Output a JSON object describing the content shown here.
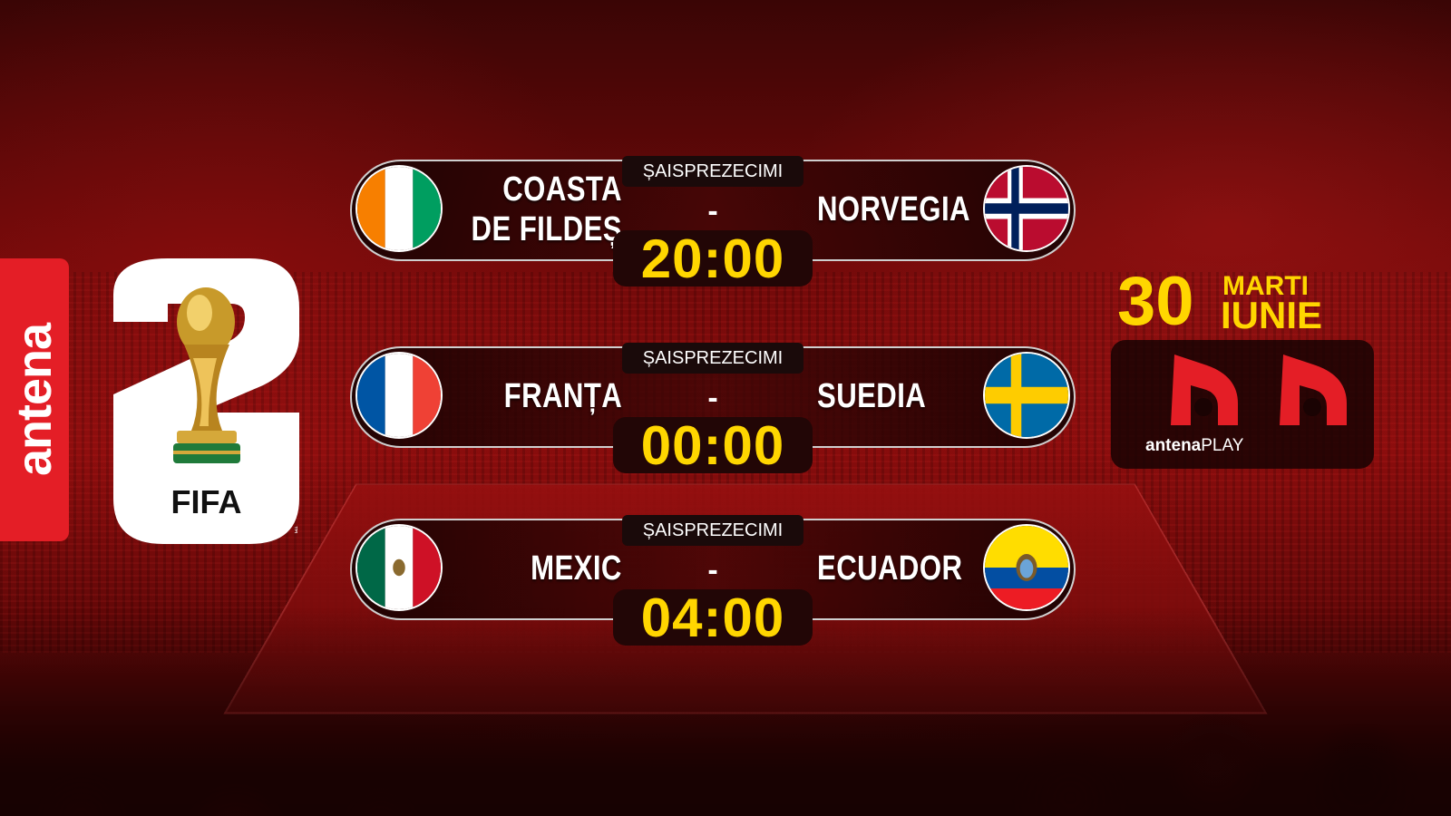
{
  "brand": {
    "channel": "antena",
    "tournament_logo_text": "FIFA",
    "tm": "™"
  },
  "matches": [
    {
      "stage": "ȘAISPREZECIMI",
      "home": "COASTA DE FILDEȘ",
      "home_lines": [
        "COASTA",
        "DE FILDEȘ"
      ],
      "away": "NORVEGIA",
      "separator": "-",
      "time": "20:00",
      "home_flag": "ivory-coast-flag-icon",
      "away_flag": "norway-flag-icon"
    },
    {
      "stage": "ȘAISPREZECIMI",
      "home": "FRANȚA",
      "away": "SUEDIA",
      "separator": "-",
      "time": "00:00",
      "home_flag": "france-flag-icon",
      "away_flag": "sweden-flag-icon"
    },
    {
      "stage": "ȘAISPREZECIMI",
      "home": "MEXIC",
      "away": "ECUADOR",
      "separator": "-",
      "time": "04:00",
      "home_flag": "mexico-flag-icon",
      "away_flag": "ecuador-flag-icon"
    }
  ],
  "date": {
    "day": "30",
    "weekday": "MARTI",
    "month": "IUNIE"
  },
  "broadcast": {
    "platform_prefix": "antena",
    "platform_suffix": "PLAY"
  },
  "colors": {
    "accent_yellow": "#ffd600",
    "antena_red": "#e41e26",
    "background_red": "#8b0d0d"
  }
}
